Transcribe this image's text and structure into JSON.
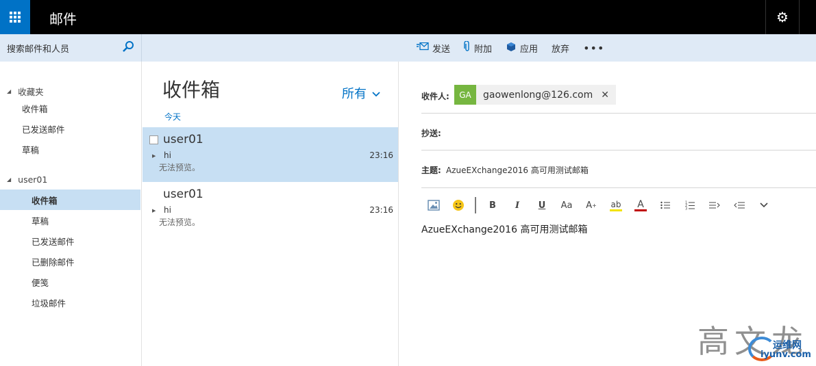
{
  "app": {
    "title": "邮件"
  },
  "search": {
    "placeholder": "搜索邮件和人员"
  },
  "toolbar": {
    "send": "发送",
    "attach": "附加",
    "apps": "应用",
    "discard": "放弃",
    "more": "•••"
  },
  "folders": {
    "favorites_label": "收藏夹",
    "favorites": [
      "收件箱",
      "已发送邮件",
      "草稿"
    ],
    "account_label": "user01",
    "account_items": [
      "收件箱",
      "草稿",
      "已发送邮件",
      "已删除邮件",
      "便笺",
      "垃圾邮件"
    ],
    "selected": "收件箱"
  },
  "list": {
    "title": "收件箱",
    "filter": "所有",
    "group": "今天",
    "messages": [
      {
        "sender": "user01",
        "subject": "hi",
        "time": "23:16",
        "preview": "无法预览。"
      },
      {
        "sender": "user01",
        "subject": "hi",
        "time": "23:16",
        "preview": "无法预览。"
      }
    ]
  },
  "compose": {
    "to_label": "收件人:",
    "recipient_initials": "GA",
    "recipient_email": "gaowenlong@126.com",
    "cc_label": "抄送:",
    "subject_label": "主题:",
    "subject_value": "AzueEXchange2016 高可用测试邮箱",
    "body": "AzueEXchange2016 高可用测试邮箱"
  },
  "format_toolbar": [
    "picture-icon",
    "emoji-icon",
    "bold-icon",
    "italic-icon",
    "underline-icon",
    "font-size-icon",
    "grow-font-icon",
    "highlight-icon",
    "font-color-icon",
    "bullets-icon",
    "numbering-icon",
    "increase-indent-icon",
    "decrease-indent-icon",
    "more-formatting-icon"
  ],
  "colors": {
    "brand": "#0072c6",
    "selection": "#c7dff3",
    "command_bar": "#dfeaf6",
    "avatar": "#76b640"
  },
  "watermark": {
    "signature": "高文龙",
    "site_name": "运维网",
    "site_url": "iyunv.com"
  }
}
